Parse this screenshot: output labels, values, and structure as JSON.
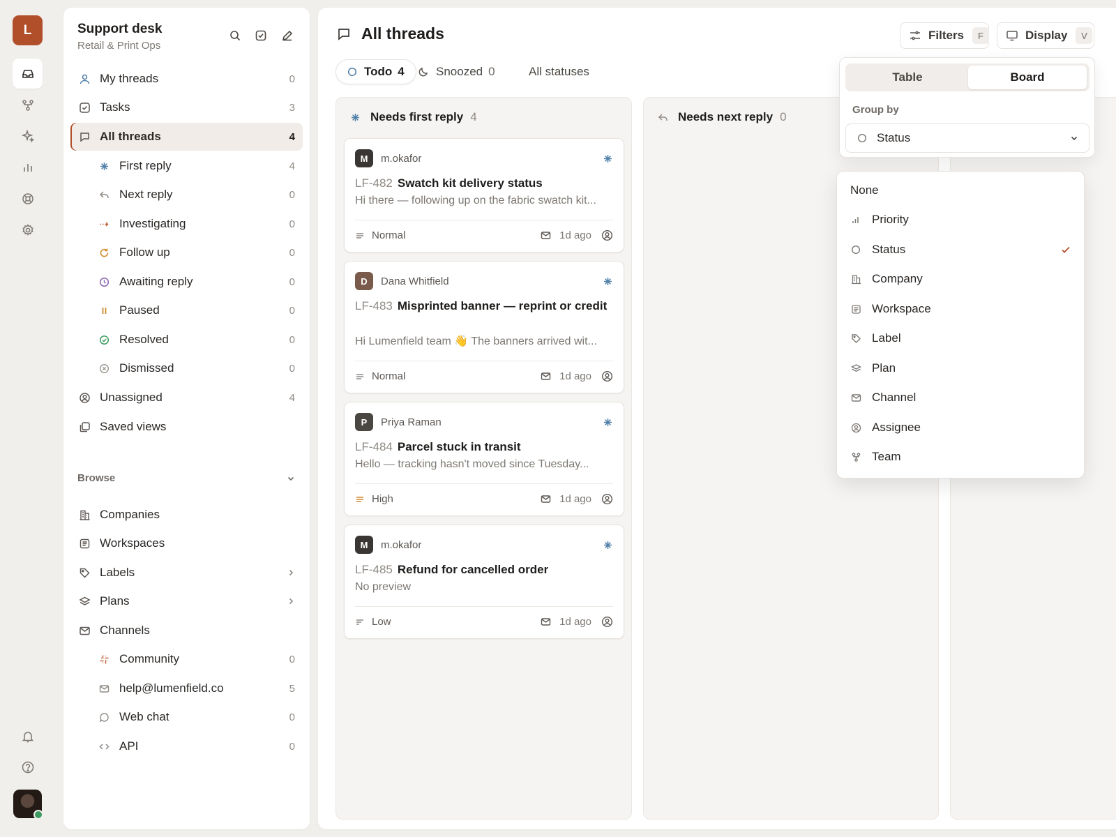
{
  "workspace_initial": "L",
  "sidebar": {
    "title": "Support desk",
    "subtitle": "Retail & Print Ops",
    "nav": [
      {
        "label": "My threads",
        "count": "0"
      },
      {
        "label": "Tasks",
        "count": "3"
      },
      {
        "label": "All threads",
        "count": "4"
      },
      {
        "label": "First reply",
        "count": "4"
      },
      {
        "label": "Next reply",
        "count": "0"
      },
      {
        "label": "Investigating",
        "count": "0"
      },
      {
        "label": "Follow up",
        "count": "0"
      },
      {
        "label": "Awaiting reply",
        "count": "0"
      },
      {
        "label": "Paused",
        "count": "0"
      },
      {
        "label": "Resolved",
        "count": "0"
      },
      {
        "label": "Dismissed",
        "count": "0"
      },
      {
        "label": "Unassigned",
        "count": "4"
      },
      {
        "label": "Saved views",
        "count": ""
      }
    ],
    "browse_label": "Browse",
    "browse": [
      {
        "label": "Companies",
        "count": ""
      },
      {
        "label": "Workspaces",
        "count": ""
      },
      {
        "label": "Labels",
        "count": ""
      },
      {
        "label": "Plans",
        "count": ""
      },
      {
        "label": "Channels",
        "count": ""
      },
      {
        "label": "Community",
        "count": "0"
      },
      {
        "label": "help@lumenfield.co",
        "count": "5"
      },
      {
        "label": "Web chat",
        "count": "0"
      },
      {
        "label": "API",
        "count": "0"
      }
    ]
  },
  "header": {
    "title": "All threads",
    "filters_label": "Filters",
    "filters_key": "F",
    "display_label": "Display",
    "display_key": "V"
  },
  "tabs": [
    {
      "label": "Todo",
      "count": "4"
    },
    {
      "label": "Snoozed",
      "count": "0"
    },
    {
      "label": "All statuses",
      "count": ""
    }
  ],
  "columns": [
    {
      "title": "Needs first reply",
      "count": "4"
    },
    {
      "title": "Needs next reply",
      "count": "0"
    }
  ],
  "cards": [
    {
      "initial": "M",
      "avatar_color": "#3a3633",
      "author": "m.okafor",
      "id": "LF-482",
      "title": "Swatch kit delivery status",
      "preview": "Hi there — following up on the fabric swatch kit...",
      "priority": "Normal",
      "time": "1d ago"
    },
    {
      "initial": "D",
      "avatar_color": "#7a5a4a",
      "author": "Dana Whitfield",
      "id": "LF-483",
      "title": "Misprinted banner — reprint or credit",
      "preview": "Hi Lumenfield team 👋 The banners arrived wit...",
      "priority": "Normal",
      "time": "1d ago"
    },
    {
      "initial": "P",
      "avatar_color": "#4a4642",
      "author": "Priya Raman",
      "id": "LF-484",
      "title": "Parcel stuck in transit",
      "preview": "Hello — tracking hasn't moved since Tuesday...",
      "priority": "High",
      "time": "1d ago"
    },
    {
      "initial": "M",
      "avatar_color": "#3a3633",
      "author": "m.okafor",
      "id": "LF-485",
      "title": "Refund for cancelled order",
      "preview": "No preview",
      "priority": "Low",
      "time": "1d ago"
    }
  ],
  "display": {
    "views": [
      "Table",
      "Board"
    ],
    "selected_view": "Board",
    "group_by_label": "Group by",
    "group_by_value": "Status",
    "options": [
      "None",
      "Priority",
      "Status",
      "Company",
      "Workspace",
      "Label",
      "Plan",
      "Channel",
      "Assignee",
      "Team"
    ],
    "selected_option": "Status"
  },
  "colors": {
    "accent": "#b14f2b",
    "first_reply": "#4f7fa8",
    "investigating": "#c0623a",
    "follow_up": "#d08a2e",
    "awaiting": "#8a62b0",
    "resolved": "#3b9b5e"
  }
}
